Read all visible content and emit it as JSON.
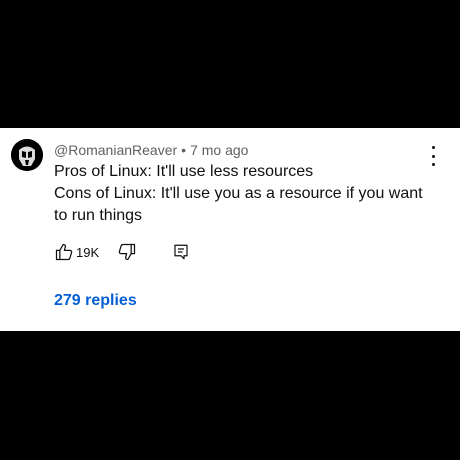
{
  "comment": {
    "author": "@RomanianReaver",
    "separator": "•",
    "time": "7 mo ago",
    "text_lines": [
      "Pros of Linux: It'll use less resources",
      "Cons of Linux: It'll use you as a resource if you want",
      "to run things"
    ],
    "likes": "19K",
    "replies": "279 replies"
  },
  "icons": {
    "avatar": "helmet-avatar",
    "more": "kebab-menu-icon",
    "like": "thumbs-up-icon",
    "dislike": "thumbs-down-icon",
    "reply": "reply-icon"
  },
  "colors": {
    "background": "#ffffff",
    "text": "#0f0f0f",
    "meta": "#606060",
    "link": "#065fd4",
    "frame": "#000000"
  }
}
